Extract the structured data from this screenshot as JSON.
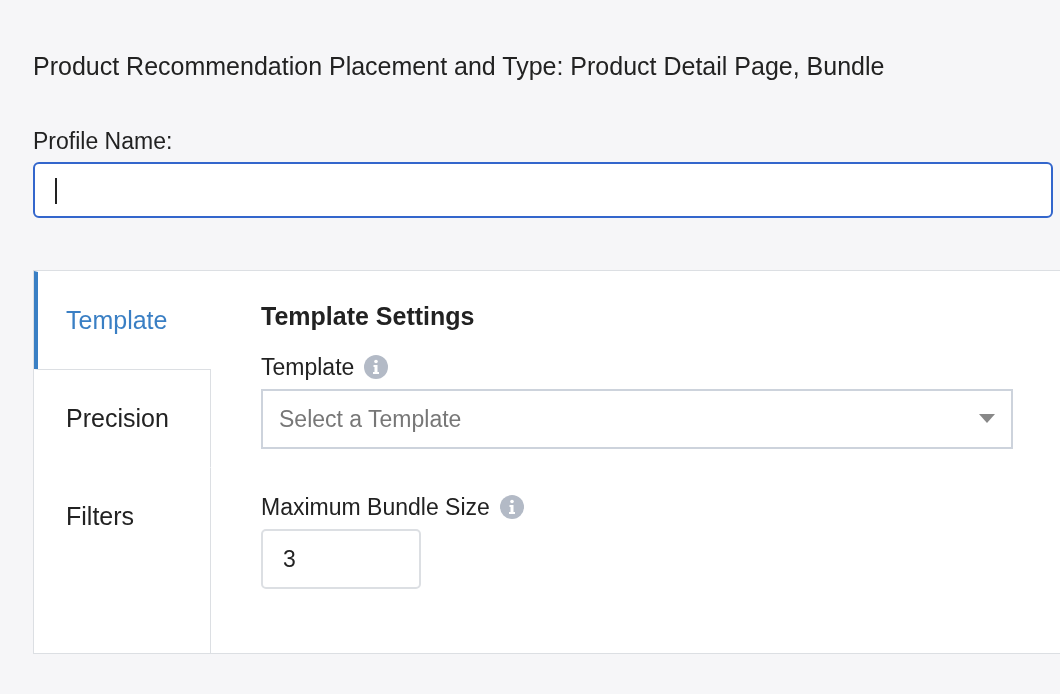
{
  "header": {
    "text": "Product Recommendation Placement and Type: Product Detail Page, Bundle"
  },
  "profile_name": {
    "label": "Profile Name:",
    "focused": true
  },
  "tabs": [
    {
      "label": "Template",
      "selected": true
    },
    {
      "label": "Precision",
      "selected": false
    },
    {
      "label": "Filters",
      "selected": false
    }
  ],
  "settings": {
    "title": "Template Settings",
    "template": {
      "label": "Template",
      "placeholder": "Select a Template"
    },
    "bundle_size": {
      "label": "Maximum Bundle Size",
      "value": "3"
    }
  }
}
